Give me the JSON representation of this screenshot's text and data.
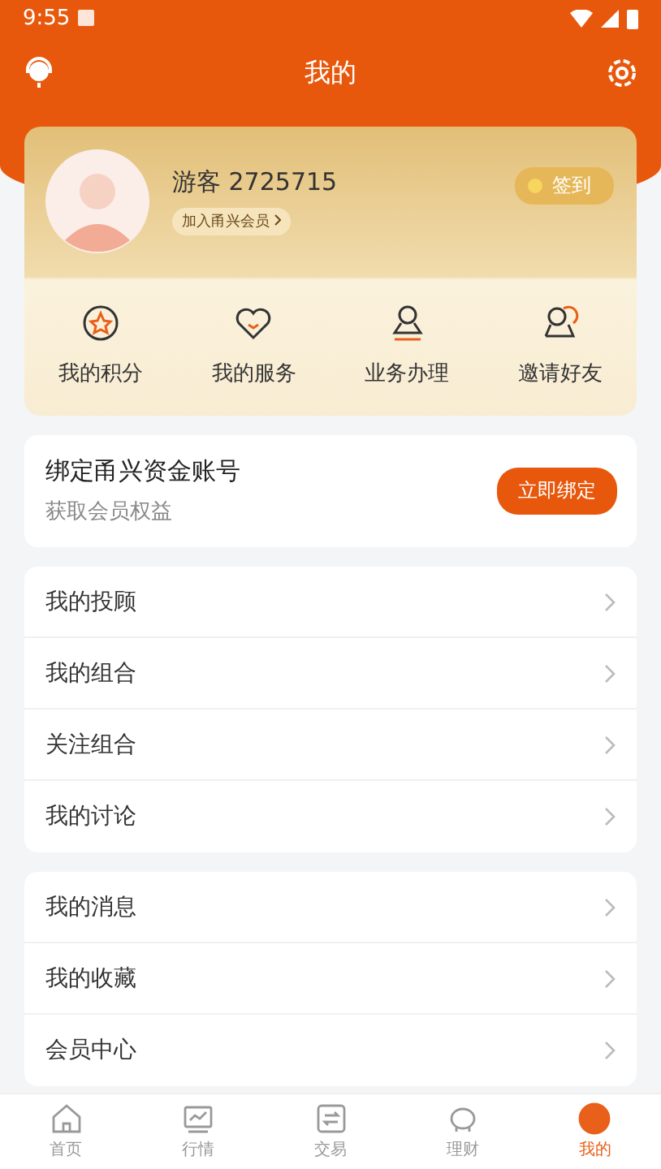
{
  "status_bar": {
    "time": "9:55"
  },
  "header": {
    "title": "我的"
  },
  "profile": {
    "name": "游客 2725715",
    "member_link": "加入甬兴会员",
    "checkin": "签到"
  },
  "shortcuts": [
    {
      "label": "我的积分",
      "kind": "star"
    },
    {
      "label": "我的服务",
      "kind": "heart"
    },
    {
      "label": "业务办理",
      "kind": "stamp"
    },
    {
      "label": "邀请好友",
      "kind": "people"
    }
  ],
  "bind": {
    "title": "绑定甬兴资金账号",
    "subtitle": "获取会员权益",
    "button": "立即绑定"
  },
  "groups": [
    {
      "items": [
        "我的投顾",
        "我的组合",
        "关注组合",
        "我的讨论"
      ]
    },
    {
      "items": [
        "我的消息",
        "我的收藏",
        "会员中心"
      ]
    }
  ],
  "tabs": [
    {
      "label": "首页",
      "kind": "home",
      "selected": false
    },
    {
      "label": "行情",
      "kind": "chart",
      "selected": false
    },
    {
      "label": "交易",
      "kind": "swap",
      "selected": false
    },
    {
      "label": "理财",
      "kind": "piggy",
      "selected": false
    },
    {
      "label": "我的",
      "kind": "me",
      "selected": true
    }
  ]
}
